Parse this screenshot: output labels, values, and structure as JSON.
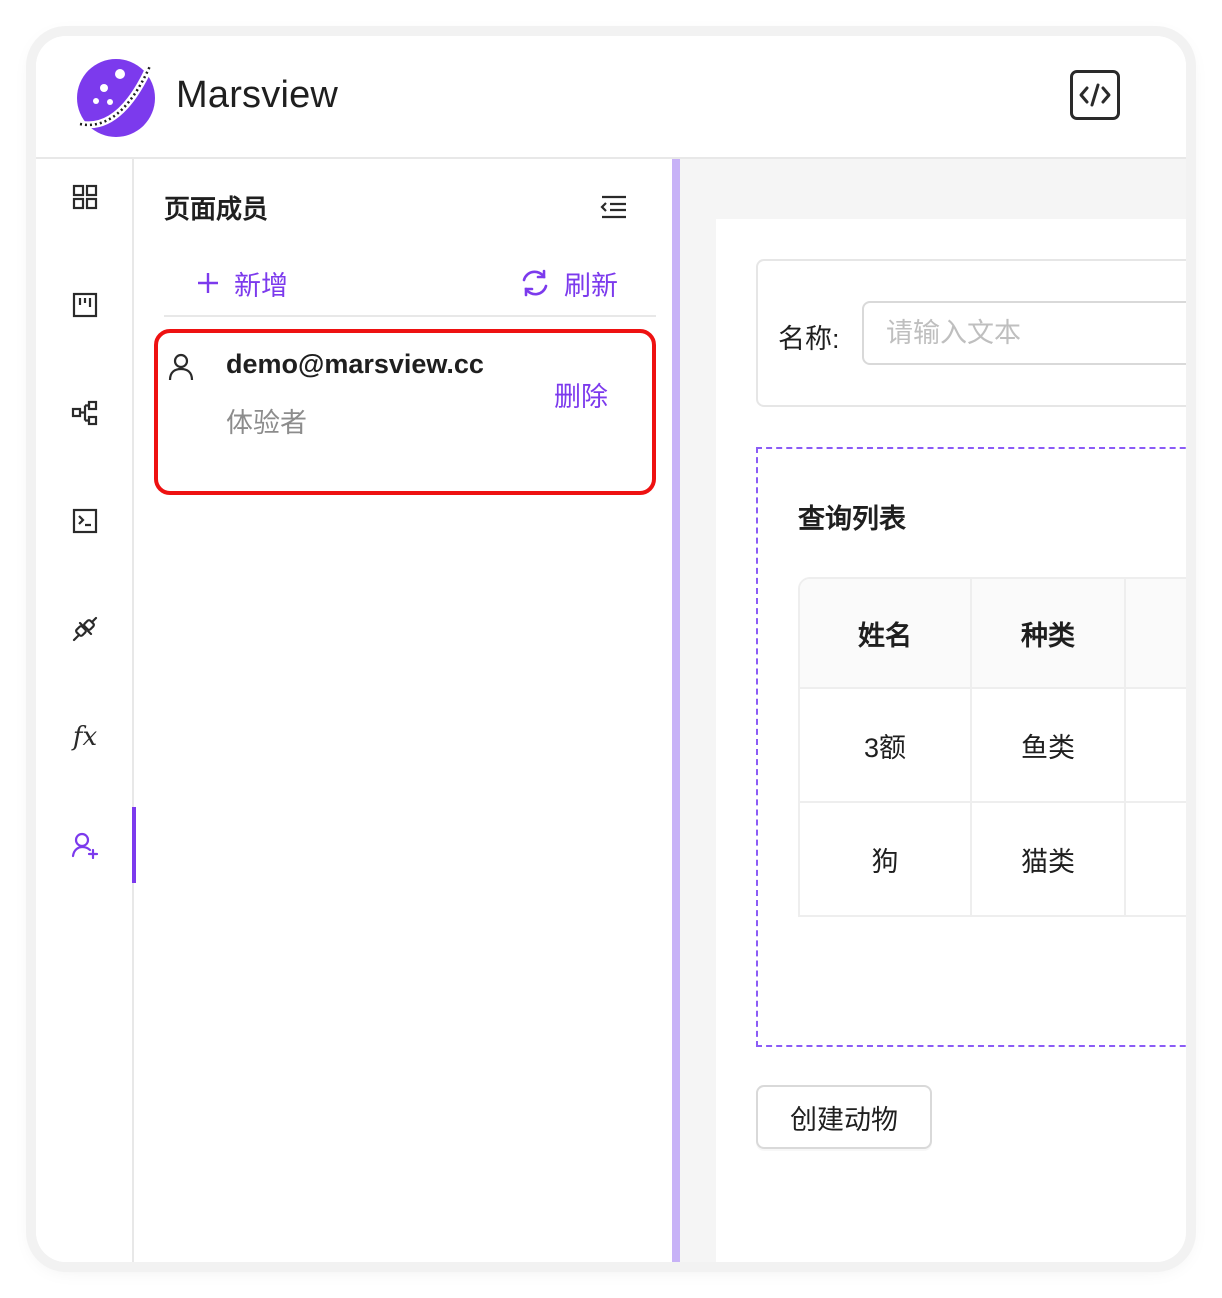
{
  "app": {
    "brand": "Marsview"
  },
  "header": {
    "code_button_icon": "code-icon"
  },
  "rail": {
    "items": [
      {
        "icon": "grid-icon"
      },
      {
        "icon": "kanban-icon"
      },
      {
        "icon": "tree-structure-icon"
      },
      {
        "icon": "terminal-icon"
      },
      {
        "icon": "api-plug-icon"
      },
      {
        "icon": "function-icon",
        "label": "fx"
      },
      {
        "icon": "user-add-icon",
        "active": true
      }
    ]
  },
  "members": {
    "title": "页面成员",
    "add_label": "新增",
    "refresh_label": "刷新",
    "list": [
      {
        "email": "demo@marsview.cc",
        "role": "体验者",
        "delete_label": "删除"
      }
    ]
  },
  "canvas": {
    "search": {
      "label": "名称:",
      "placeholder": "请输入文本"
    },
    "list_title": "查询列表",
    "table": {
      "columns": [
        "姓名",
        "种类",
        ""
      ],
      "rows": [
        [
          "3额",
          "鱼类",
          ""
        ],
        [
          "狗",
          "猫类",
          ""
        ]
      ]
    },
    "create_button": "创建动物"
  },
  "colors": {
    "accent": "#7c3aed",
    "highlight_border": "#ee1111",
    "splitter": "#c7b2f7"
  }
}
